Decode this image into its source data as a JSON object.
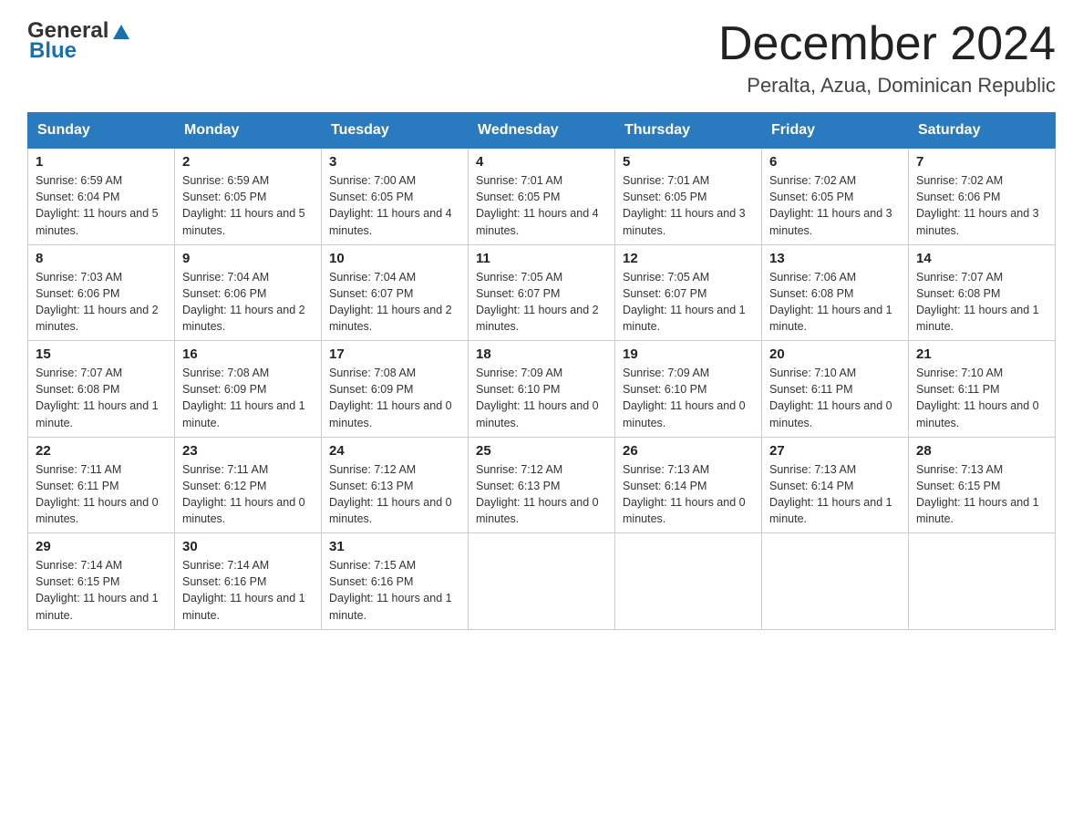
{
  "header": {
    "logo": {
      "general": "General",
      "blue": "Blue"
    },
    "title": "December 2024",
    "subtitle": "Peralta, Azua, Dominican Republic"
  },
  "days_of_week": [
    "Sunday",
    "Monday",
    "Tuesday",
    "Wednesday",
    "Thursday",
    "Friday",
    "Saturday"
  ],
  "weeks": [
    [
      {
        "day": "1",
        "sunrise": "6:59 AM",
        "sunset": "6:04 PM",
        "daylight": "11 hours and 5 minutes."
      },
      {
        "day": "2",
        "sunrise": "6:59 AM",
        "sunset": "6:05 PM",
        "daylight": "11 hours and 5 minutes."
      },
      {
        "day": "3",
        "sunrise": "7:00 AM",
        "sunset": "6:05 PM",
        "daylight": "11 hours and 4 minutes."
      },
      {
        "day": "4",
        "sunrise": "7:01 AM",
        "sunset": "6:05 PM",
        "daylight": "11 hours and 4 minutes."
      },
      {
        "day": "5",
        "sunrise": "7:01 AM",
        "sunset": "6:05 PM",
        "daylight": "11 hours and 3 minutes."
      },
      {
        "day": "6",
        "sunrise": "7:02 AM",
        "sunset": "6:05 PM",
        "daylight": "11 hours and 3 minutes."
      },
      {
        "day": "7",
        "sunrise": "7:02 AM",
        "sunset": "6:06 PM",
        "daylight": "11 hours and 3 minutes."
      }
    ],
    [
      {
        "day": "8",
        "sunrise": "7:03 AM",
        "sunset": "6:06 PM",
        "daylight": "11 hours and 2 minutes."
      },
      {
        "day": "9",
        "sunrise": "7:04 AM",
        "sunset": "6:06 PM",
        "daylight": "11 hours and 2 minutes."
      },
      {
        "day": "10",
        "sunrise": "7:04 AM",
        "sunset": "6:07 PM",
        "daylight": "11 hours and 2 minutes."
      },
      {
        "day": "11",
        "sunrise": "7:05 AM",
        "sunset": "6:07 PM",
        "daylight": "11 hours and 2 minutes."
      },
      {
        "day": "12",
        "sunrise": "7:05 AM",
        "sunset": "6:07 PM",
        "daylight": "11 hours and 1 minute."
      },
      {
        "day": "13",
        "sunrise": "7:06 AM",
        "sunset": "6:08 PM",
        "daylight": "11 hours and 1 minute."
      },
      {
        "day": "14",
        "sunrise": "7:07 AM",
        "sunset": "6:08 PM",
        "daylight": "11 hours and 1 minute."
      }
    ],
    [
      {
        "day": "15",
        "sunrise": "7:07 AM",
        "sunset": "6:08 PM",
        "daylight": "11 hours and 1 minute."
      },
      {
        "day": "16",
        "sunrise": "7:08 AM",
        "sunset": "6:09 PM",
        "daylight": "11 hours and 1 minute."
      },
      {
        "day": "17",
        "sunrise": "7:08 AM",
        "sunset": "6:09 PM",
        "daylight": "11 hours and 0 minutes."
      },
      {
        "day": "18",
        "sunrise": "7:09 AM",
        "sunset": "6:10 PM",
        "daylight": "11 hours and 0 minutes."
      },
      {
        "day": "19",
        "sunrise": "7:09 AM",
        "sunset": "6:10 PM",
        "daylight": "11 hours and 0 minutes."
      },
      {
        "day": "20",
        "sunrise": "7:10 AM",
        "sunset": "6:11 PM",
        "daylight": "11 hours and 0 minutes."
      },
      {
        "day": "21",
        "sunrise": "7:10 AM",
        "sunset": "6:11 PM",
        "daylight": "11 hours and 0 minutes."
      }
    ],
    [
      {
        "day": "22",
        "sunrise": "7:11 AM",
        "sunset": "6:11 PM",
        "daylight": "11 hours and 0 minutes."
      },
      {
        "day": "23",
        "sunrise": "7:11 AM",
        "sunset": "6:12 PM",
        "daylight": "11 hours and 0 minutes."
      },
      {
        "day": "24",
        "sunrise": "7:12 AM",
        "sunset": "6:13 PM",
        "daylight": "11 hours and 0 minutes."
      },
      {
        "day": "25",
        "sunrise": "7:12 AM",
        "sunset": "6:13 PM",
        "daylight": "11 hours and 0 minutes."
      },
      {
        "day": "26",
        "sunrise": "7:13 AM",
        "sunset": "6:14 PM",
        "daylight": "11 hours and 0 minutes."
      },
      {
        "day": "27",
        "sunrise": "7:13 AM",
        "sunset": "6:14 PM",
        "daylight": "11 hours and 1 minute."
      },
      {
        "day": "28",
        "sunrise": "7:13 AM",
        "sunset": "6:15 PM",
        "daylight": "11 hours and 1 minute."
      }
    ],
    [
      {
        "day": "29",
        "sunrise": "7:14 AM",
        "sunset": "6:15 PM",
        "daylight": "11 hours and 1 minute."
      },
      {
        "day": "30",
        "sunrise": "7:14 AM",
        "sunset": "6:16 PM",
        "daylight": "11 hours and 1 minute."
      },
      {
        "day": "31",
        "sunrise": "7:15 AM",
        "sunset": "6:16 PM",
        "daylight": "11 hours and 1 minute."
      },
      null,
      null,
      null,
      null
    ]
  ],
  "labels": {
    "sunrise": "Sunrise:",
    "sunset": "Sunset:",
    "daylight": "Daylight:"
  }
}
